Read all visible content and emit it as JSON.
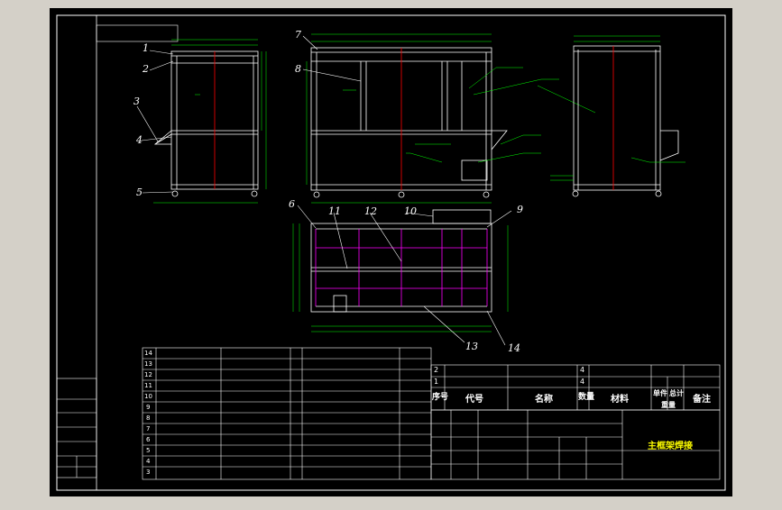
{
  "colors": {
    "background": "#000000",
    "frame": "#ffffff",
    "structure": "#ffffff",
    "dimension": "#00ff00",
    "leader": "#00ff00",
    "centerline": "#ff0000",
    "hidden": "#ff00ff",
    "table_text": "#ffffff",
    "title_text": "#ffff00",
    "balloon": "#ffffff",
    "outer_bg": "#d4d0c8"
  },
  "balloons": {
    "b1": "1",
    "b2": "2",
    "b3": "3",
    "b4": "4",
    "b5": "5",
    "b6": "6",
    "b7": "7",
    "b8": "8",
    "b9": "9",
    "b10": "10",
    "b11": "11",
    "b12": "12",
    "b13": "13",
    "b14": "14"
  },
  "title_block": {
    "drawing_title": "主框架焊接"
  },
  "bom_headers": {
    "seq": "序号",
    "code": "代号",
    "name": "名称",
    "qty": "数量",
    "material": "材料",
    "unit": "单件",
    "total": "总计",
    "weight": "重量",
    "remark": "备注"
  },
  "bom_rows": [
    {
      "seq": "14",
      "remark": ""
    },
    {
      "seq": "13",
      "remark": ""
    },
    {
      "seq": "12",
      "remark": ""
    },
    {
      "seq": "11",
      "remark": ""
    },
    {
      "seq": "10",
      "remark": ""
    },
    {
      "seq": "9",
      "remark": ""
    },
    {
      "seq": "8",
      "remark": ""
    },
    {
      "seq": "7",
      "remark": ""
    },
    {
      "seq": "6",
      "remark": ""
    },
    {
      "seq": "5",
      "remark": ""
    },
    {
      "seq": "4",
      "remark": ""
    },
    {
      "seq": "3",
      "remark": ""
    }
  ],
  "bom_upper": [
    {
      "seq": "2",
      "qty": "4"
    },
    {
      "seq": "1",
      "qty": "4"
    }
  ]
}
